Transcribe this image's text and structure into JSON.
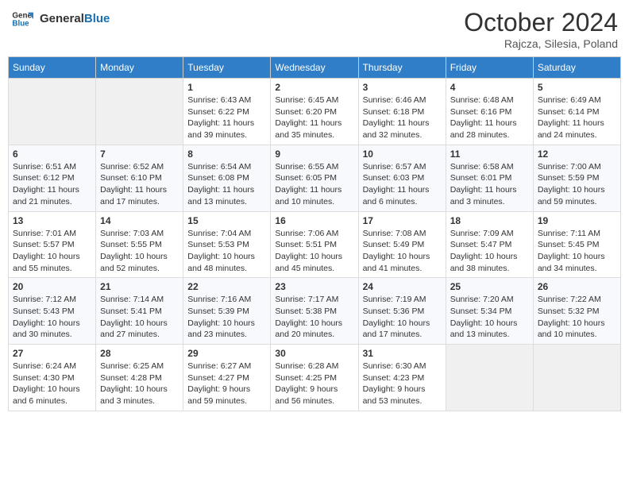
{
  "header": {
    "logo_general": "General",
    "logo_blue": "Blue",
    "title": "October 2024",
    "location": "Rajcza, Silesia, Poland"
  },
  "days_of_week": [
    "Sunday",
    "Monday",
    "Tuesday",
    "Wednesday",
    "Thursday",
    "Friday",
    "Saturday"
  ],
  "weeks": [
    [
      {
        "day": "",
        "info": ""
      },
      {
        "day": "",
        "info": ""
      },
      {
        "day": "1",
        "info": "Sunrise: 6:43 AM\nSunset: 6:22 PM\nDaylight: 11 hours and 39 minutes."
      },
      {
        "day": "2",
        "info": "Sunrise: 6:45 AM\nSunset: 6:20 PM\nDaylight: 11 hours and 35 minutes."
      },
      {
        "day": "3",
        "info": "Sunrise: 6:46 AM\nSunset: 6:18 PM\nDaylight: 11 hours and 32 minutes."
      },
      {
        "day": "4",
        "info": "Sunrise: 6:48 AM\nSunset: 6:16 PM\nDaylight: 11 hours and 28 minutes."
      },
      {
        "day": "5",
        "info": "Sunrise: 6:49 AM\nSunset: 6:14 PM\nDaylight: 11 hours and 24 minutes."
      }
    ],
    [
      {
        "day": "6",
        "info": "Sunrise: 6:51 AM\nSunset: 6:12 PM\nDaylight: 11 hours and 21 minutes."
      },
      {
        "day": "7",
        "info": "Sunrise: 6:52 AM\nSunset: 6:10 PM\nDaylight: 11 hours and 17 minutes."
      },
      {
        "day": "8",
        "info": "Sunrise: 6:54 AM\nSunset: 6:08 PM\nDaylight: 11 hours and 13 minutes."
      },
      {
        "day": "9",
        "info": "Sunrise: 6:55 AM\nSunset: 6:05 PM\nDaylight: 11 hours and 10 minutes."
      },
      {
        "day": "10",
        "info": "Sunrise: 6:57 AM\nSunset: 6:03 PM\nDaylight: 11 hours and 6 minutes."
      },
      {
        "day": "11",
        "info": "Sunrise: 6:58 AM\nSunset: 6:01 PM\nDaylight: 11 hours and 3 minutes."
      },
      {
        "day": "12",
        "info": "Sunrise: 7:00 AM\nSunset: 5:59 PM\nDaylight: 10 hours and 59 minutes."
      }
    ],
    [
      {
        "day": "13",
        "info": "Sunrise: 7:01 AM\nSunset: 5:57 PM\nDaylight: 10 hours and 55 minutes."
      },
      {
        "day": "14",
        "info": "Sunrise: 7:03 AM\nSunset: 5:55 PM\nDaylight: 10 hours and 52 minutes."
      },
      {
        "day": "15",
        "info": "Sunrise: 7:04 AM\nSunset: 5:53 PM\nDaylight: 10 hours and 48 minutes."
      },
      {
        "day": "16",
        "info": "Sunrise: 7:06 AM\nSunset: 5:51 PM\nDaylight: 10 hours and 45 minutes."
      },
      {
        "day": "17",
        "info": "Sunrise: 7:08 AM\nSunset: 5:49 PM\nDaylight: 10 hours and 41 minutes."
      },
      {
        "day": "18",
        "info": "Sunrise: 7:09 AM\nSunset: 5:47 PM\nDaylight: 10 hours and 38 minutes."
      },
      {
        "day": "19",
        "info": "Sunrise: 7:11 AM\nSunset: 5:45 PM\nDaylight: 10 hours and 34 minutes."
      }
    ],
    [
      {
        "day": "20",
        "info": "Sunrise: 7:12 AM\nSunset: 5:43 PM\nDaylight: 10 hours and 30 minutes."
      },
      {
        "day": "21",
        "info": "Sunrise: 7:14 AM\nSunset: 5:41 PM\nDaylight: 10 hours and 27 minutes."
      },
      {
        "day": "22",
        "info": "Sunrise: 7:16 AM\nSunset: 5:39 PM\nDaylight: 10 hours and 23 minutes."
      },
      {
        "day": "23",
        "info": "Sunrise: 7:17 AM\nSunset: 5:38 PM\nDaylight: 10 hours and 20 minutes."
      },
      {
        "day": "24",
        "info": "Sunrise: 7:19 AM\nSunset: 5:36 PM\nDaylight: 10 hours and 17 minutes."
      },
      {
        "day": "25",
        "info": "Sunrise: 7:20 AM\nSunset: 5:34 PM\nDaylight: 10 hours and 13 minutes."
      },
      {
        "day": "26",
        "info": "Sunrise: 7:22 AM\nSunset: 5:32 PM\nDaylight: 10 hours and 10 minutes."
      }
    ],
    [
      {
        "day": "27",
        "info": "Sunrise: 6:24 AM\nSunset: 4:30 PM\nDaylight: 10 hours and 6 minutes."
      },
      {
        "day": "28",
        "info": "Sunrise: 6:25 AM\nSunset: 4:28 PM\nDaylight: 10 hours and 3 minutes."
      },
      {
        "day": "29",
        "info": "Sunrise: 6:27 AM\nSunset: 4:27 PM\nDaylight: 9 hours and 59 minutes."
      },
      {
        "day": "30",
        "info": "Sunrise: 6:28 AM\nSunset: 4:25 PM\nDaylight: 9 hours and 56 minutes."
      },
      {
        "day": "31",
        "info": "Sunrise: 6:30 AM\nSunset: 4:23 PM\nDaylight: 9 hours and 53 minutes."
      },
      {
        "day": "",
        "info": ""
      },
      {
        "day": "",
        "info": ""
      }
    ]
  ]
}
